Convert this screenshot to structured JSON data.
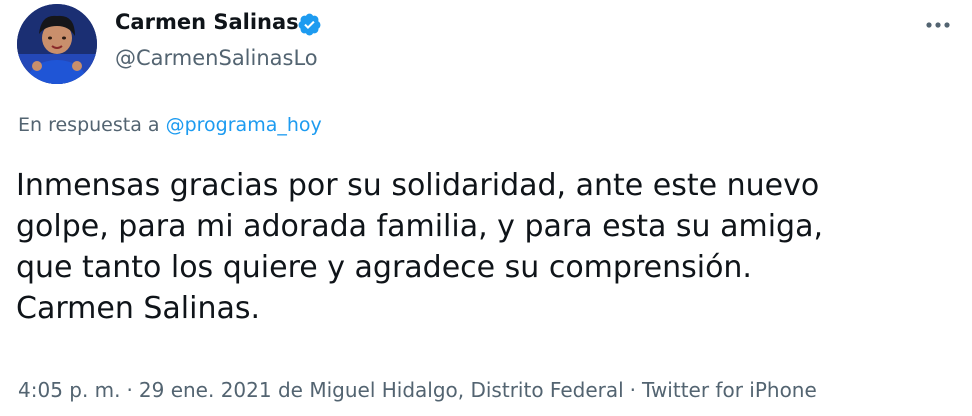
{
  "author": {
    "display_name": "Carmen Salinas",
    "username": "@CarmenSalinasLo",
    "verified_icon": "verified-badge-icon"
  },
  "reply": {
    "prefix": "En respuesta a",
    "mention": "@programa_hoy"
  },
  "tweet": {
    "lines": [
      "Inmensas gracias por su solidaridad, ante este nuevo",
      "golpe, para mi adorada familia, y para esta su amiga,",
      "que tanto los quiere y agradece su comprensión.",
      "Carmen Salinas."
    ]
  },
  "meta": {
    "time": "4:05 p. m.",
    "date": "29 ene. 2021",
    "location": "de Miguel Hidalgo, Distrito Federal",
    "source": "Twitter for iPhone",
    "separator": "·"
  },
  "icons": {
    "more": "more-horizontal-icon"
  },
  "colors": {
    "text_primary": "#0f1419",
    "text_secondary": "#536471",
    "accent": "#1d9bf0"
  }
}
